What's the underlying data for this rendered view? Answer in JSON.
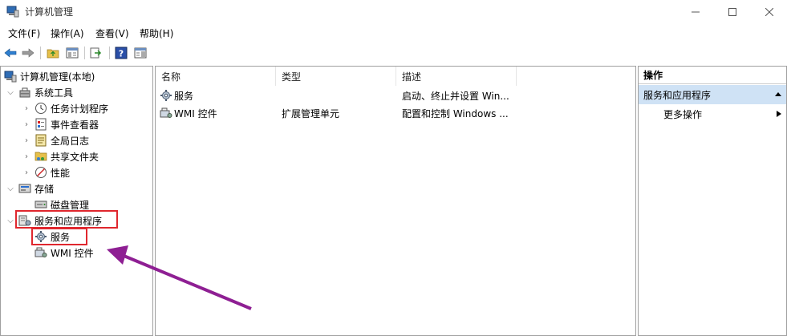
{
  "window": {
    "title": "计算机管理"
  },
  "menu": [
    "文件(F)",
    "操作(A)",
    "查看(V)",
    "帮助(H)"
  ],
  "toolbar": {
    "icons": [
      "back-icon",
      "forward-icon",
      "up-folder-icon",
      "show-hide-tree-icon",
      "export-list-icon",
      "help-icon",
      "show-hide-action-pane-icon"
    ]
  },
  "tree": {
    "root": "计算机管理(本地)",
    "system_tools": "系统工具",
    "task_scheduler": "任务计划程序",
    "event_viewer": "事件查看器",
    "shared_logs": "全局日志",
    "shared_folders": "共享文件夹",
    "performance": "性能",
    "storage": "存储",
    "disk_management": "磁盘管理",
    "services_apps": "服务和应用程序",
    "services": "服务",
    "wmi_control": "WMI 控件"
  },
  "list": {
    "columns": [
      "名称",
      "类型",
      "描述"
    ],
    "rows": [
      {
        "name": "服务",
        "type": "",
        "desc": "启动、终止并设置 Win..."
      },
      {
        "name": "WMI 控件",
        "type": "扩展管理单元",
        "desc": "配置和控制 Windows ..."
      }
    ]
  },
  "actions": {
    "header": "操作",
    "section": "服务和应用程序",
    "more": "更多操作"
  },
  "colors": {
    "highlight": "#e0272e",
    "arrow": "#8e1f93",
    "selection": "#cfe2f5"
  }
}
